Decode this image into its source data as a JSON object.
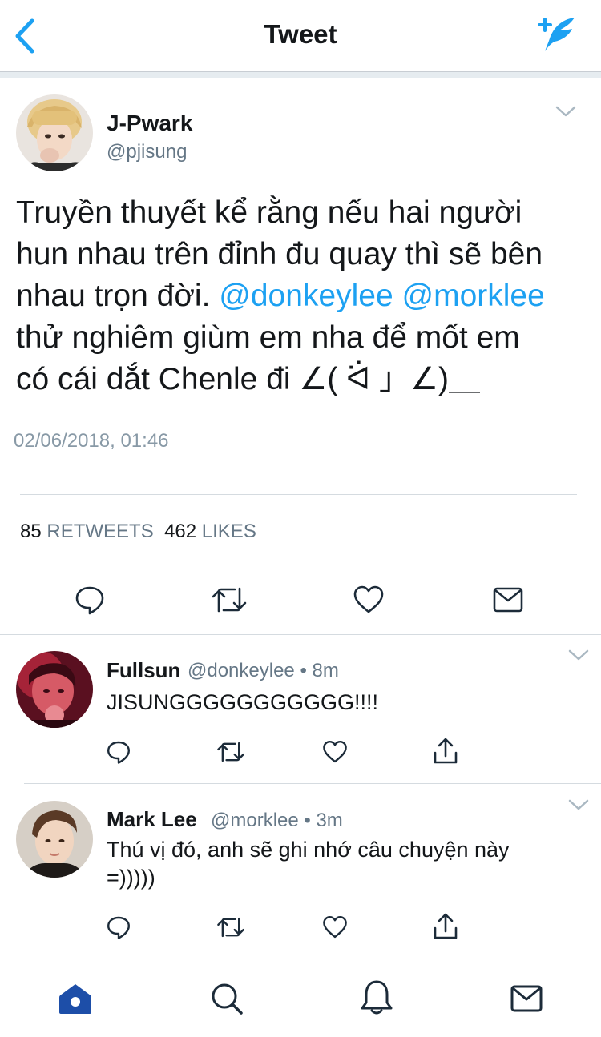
{
  "header": {
    "title": "Tweet"
  },
  "tweet": {
    "author_name": "J-Pwark",
    "author_handle": "@pjisung",
    "text_lines": [
      "Truyền thuyết kể rằng nếu hai người",
      "hun nhau trên đỉnh đu quay thì sẽ bên",
      "nhau trọn đời.",
      "@donkeylee",
      "@morklee",
      "thử nghiêm giùm em nha để mốt em",
      "có cái dắt Chenle đi ∠( ᐛ 」∠)＿"
    ],
    "timestamp": "02/06/2018, 01:46",
    "retweets_count": "85",
    "retweets_label": "RETWEETS",
    "likes_count": "462",
    "likes_label": "LIKES"
  },
  "replies": [
    {
      "name": "Fullsun",
      "meta": "@donkeylee • 8m",
      "text": "JISUNGGGGGGGGGGG!!!!"
    },
    {
      "name": "Mark Lee",
      "meta": "@morklee • 3m",
      "text_line1": "Thú vị đó, anh sẽ ghi nhớ câu chuyện này",
      "text_line2": "=)))))"
    }
  ],
  "colors": {
    "accent": "#1da1f2",
    "secondary_text": "#657786",
    "icon_gray": "#1c2b39",
    "tab_active": "#1d4ea8"
  },
  "icons": [
    "back-icon",
    "compose-icon",
    "chevron-down-icon",
    "reply-icon",
    "retweet-icon",
    "like-icon",
    "message-icon",
    "share-icon",
    "home-icon",
    "search-icon",
    "notifications-icon"
  ]
}
